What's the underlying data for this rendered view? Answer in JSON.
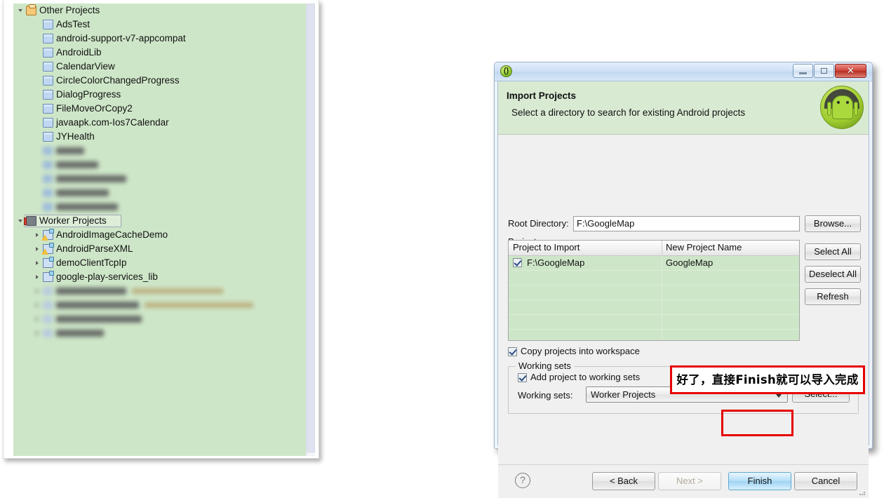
{
  "explorer": {
    "name": "package-explorer",
    "scrollbar_present": true,
    "tree": [
      {
        "label": "Other Projects",
        "icon": "working-set-orange-icon",
        "indent": 0,
        "twisty": "open",
        "blurred": false,
        "selected": false
      },
      {
        "label": "AdsTest",
        "icon": "folder-icon",
        "indent": 1,
        "twisty": "none",
        "blurred": false,
        "selected": false
      },
      {
        "label": "android-support-v7-appcompat",
        "icon": "folder-icon",
        "indent": 1,
        "twisty": "none",
        "blurred": false,
        "selected": false
      },
      {
        "label": "AndroidLib",
        "icon": "folder-icon",
        "indent": 1,
        "twisty": "none",
        "blurred": false,
        "selected": false
      },
      {
        "label": "CalendarView",
        "icon": "folder-icon",
        "indent": 1,
        "twisty": "none",
        "blurred": false,
        "selected": false
      },
      {
        "label": "CircleColorChangedProgress",
        "icon": "folder-icon",
        "indent": 1,
        "twisty": "none",
        "blurred": false,
        "selected": false
      },
      {
        "label": "DialogProgress",
        "icon": "folder-icon",
        "indent": 1,
        "twisty": "none",
        "blurred": false,
        "selected": false
      },
      {
        "label": "FileMoveOrCopy2",
        "icon": "folder-icon",
        "indent": 1,
        "twisty": "none",
        "blurred": false,
        "selected": false
      },
      {
        "label": "javaapk.com-Ios7Calendar",
        "icon": "folder-icon",
        "indent": 1,
        "twisty": "none",
        "blurred": false,
        "selected": false
      },
      {
        "label": "JYHealth",
        "icon": "folder-icon",
        "indent": 1,
        "twisty": "none",
        "blurred": false,
        "selected": false
      },
      {
        "label": "",
        "icon": "folder-icon",
        "indent": 1,
        "twisty": "none",
        "blurred": true,
        "blur_width": 40,
        "selected": false
      },
      {
        "label": "",
        "icon": "folder-icon",
        "indent": 1,
        "twisty": "none",
        "blurred": true,
        "blur_width": 60,
        "selected": false
      },
      {
        "label": "",
        "icon": "folder-icon",
        "indent": 1,
        "twisty": "none",
        "blurred": true,
        "blur_width": 100,
        "selected": false
      },
      {
        "label": "",
        "icon": "folder-icon",
        "indent": 1,
        "twisty": "none",
        "blurred": true,
        "blur_width": 75,
        "selected": false
      },
      {
        "label": "",
        "icon": "folder-icon",
        "indent": 1,
        "twisty": "none",
        "blurred": true,
        "blur_width": 88,
        "selected": false
      },
      {
        "label": "Worker Projects",
        "icon": "working-set-red-icon",
        "indent": 0,
        "twisty": "open",
        "blurred": false,
        "selected": true
      },
      {
        "label": "AndroidImageCacheDemo",
        "icon": "android-project-warning-icon",
        "indent": 1,
        "twisty": "closed",
        "blurred": false,
        "selected": false
      },
      {
        "label": "AndroidParseXML",
        "icon": "android-project-warning-icon",
        "indent": 1,
        "twisty": "closed",
        "blurred": false,
        "selected": false
      },
      {
        "label": "demoClientTcpIp",
        "icon": "android-project-icon",
        "indent": 1,
        "twisty": "closed",
        "blurred": false,
        "selected": false
      },
      {
        "label": "google-play-services_lib",
        "icon": "android-project-icon",
        "indent": 1,
        "twisty": "closed",
        "blurred": false,
        "selected": false
      },
      {
        "label": "",
        "icon": "android-project-icon",
        "indent": 1,
        "twisty": "closed",
        "blurred": true,
        "blur_width": 100,
        "blur_path_width": 130,
        "selected": false
      },
      {
        "label": "",
        "icon": "android-project-icon",
        "indent": 1,
        "twisty": "closed",
        "blurred": true,
        "blur_width": 118,
        "blur_path_width": 155,
        "selected": false
      },
      {
        "label": "",
        "icon": "android-project-icon",
        "indent": 1,
        "twisty": "closed",
        "blurred": true,
        "blur_width": 122,
        "blur_path_width": 0,
        "selected": false
      },
      {
        "label": "",
        "icon": "android-project-icon",
        "indent": 1,
        "twisty": "closed",
        "blurred": true,
        "blur_width": 68,
        "blur_path_width": 0,
        "selected": false
      }
    ]
  },
  "dialog": {
    "window_controls": {
      "minimize": "−",
      "maximize": "❐",
      "close": "✕"
    },
    "header": {
      "title": "Import Projects",
      "subtitle": "Select a directory to search for existing Android projects",
      "logo": "android-robot-icon"
    },
    "root_directory": {
      "label": "Root Directory:",
      "value": "F:\\GoogleMap",
      "placeholder": "",
      "browse_button": "Browse..."
    },
    "projects": {
      "label": "Projects:",
      "columns": [
        "Project to Import",
        "New Project Name"
      ],
      "rows": [
        {
          "checked": true,
          "project_to_import": "F:\\GoogleMap",
          "new_project_name": "GoogleMap"
        },
        {
          "checked": null,
          "project_to_import": "",
          "new_project_name": ""
        },
        {
          "checked": null,
          "project_to_import": "",
          "new_project_name": ""
        },
        {
          "checked": null,
          "project_to_import": "",
          "new_project_name": ""
        },
        {
          "checked": null,
          "project_to_import": "",
          "new_project_name": ""
        },
        {
          "checked": null,
          "project_to_import": "",
          "new_project_name": ""
        }
      ],
      "side_buttons": [
        "Select All",
        "Deselect All",
        "Refresh"
      ]
    },
    "copy_projects": {
      "label": "Copy projects into workspace",
      "checked": true
    },
    "working_sets": {
      "legend": "Working sets",
      "add_checkbox_label": "Add project to working sets",
      "add_checked": true,
      "combo_label": "Working sets:",
      "combo_value": "Worker Projects",
      "select_button": "Select..."
    },
    "buttons": {
      "help": "?",
      "back": "< Back",
      "next": "Next >",
      "next_disabled": true,
      "finish": "Finish",
      "cancel": "Cancel"
    }
  },
  "annotation": {
    "text": "好了，直接Finish就可以导入完成",
    "highlight_color": "#e60000",
    "highlights": [
      "annotation-callout",
      "finish-button"
    ]
  },
  "colors": {
    "tree_background": "#cee6c8",
    "dialog_header_green": "#d9ead3",
    "table_green": "#cee6c8",
    "accent_red": "#e60000",
    "primary_button_blue": "#9fd4f3"
  }
}
